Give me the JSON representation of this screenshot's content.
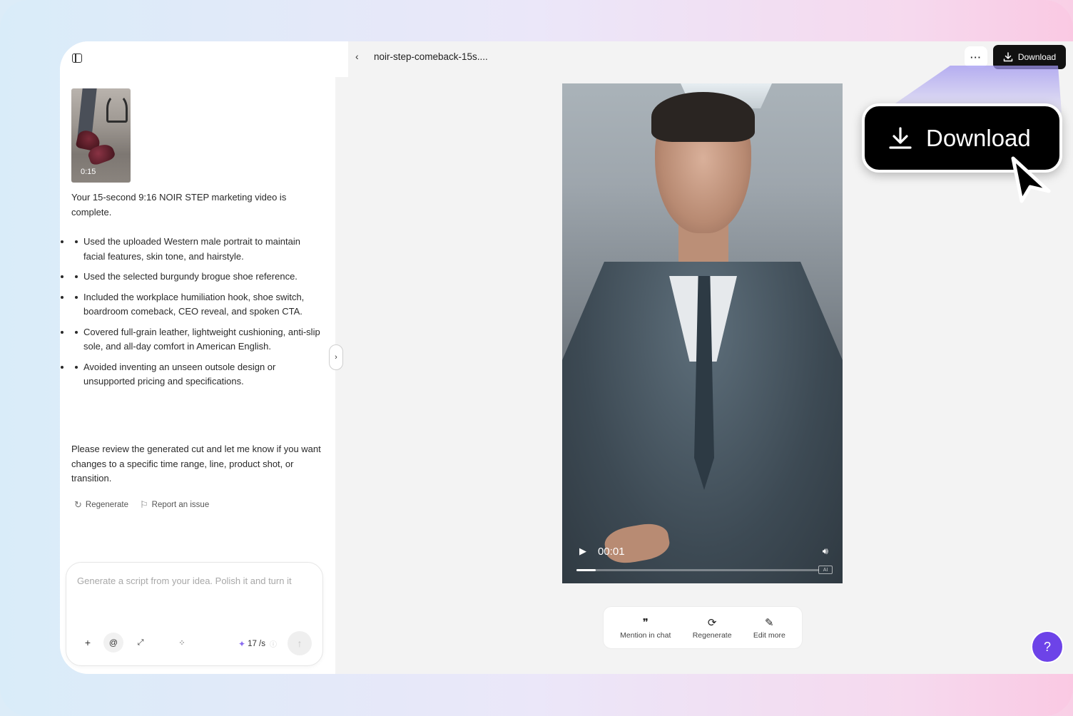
{
  "left_panel": {
    "thumbnail": {
      "duration": "0:15"
    },
    "intro": "Your 15-second 9:16 NOIR STEP marketing video is complete.",
    "bullets": [
      "Used the uploaded Western male portrait to maintain facial features, skin tone, and hairstyle.",
      "Used the selected burgundy brogue shoe reference.",
      "Included the workplace humiliation hook, shoe switch, boardroom comeback, CEO reveal, and spoken CTA.",
      "Covered full-grain leather, lightweight cushioning, anti-slip sole, and all-day comfort in American English.",
      "Avoided inventing an unseen outsole design or unsupported pricing and specifications."
    ],
    "outro": "Please review the generated cut and let me know if you want changes to a specific time range, line, product shot, or transition.",
    "actions": {
      "regenerate": "Regenerate",
      "report": "Report an issue"
    },
    "composer": {
      "placeholder": "Generate a script from your idea. Polish it and turn it",
      "credits": "17 /s"
    }
  },
  "topbar": {
    "title": "noir-step-comeback-15s....",
    "download": "Download"
  },
  "video": {
    "time": "00:01",
    "progress": 0.08
  },
  "video_tools": {
    "mention": "Mention in chat",
    "regenerate": "Regenerate",
    "edit": "Edit more"
  },
  "callout": {
    "label": "Download"
  },
  "colors": {
    "accent": "#6d43e8",
    "dark": "#111111"
  }
}
